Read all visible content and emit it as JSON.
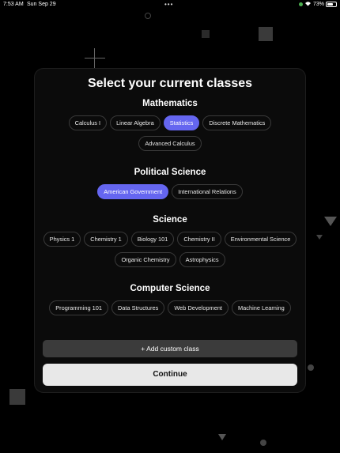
{
  "status_bar": {
    "time": "7:53 AM",
    "date": "Sun Sep 29",
    "dots": "•••",
    "battery_text": "73%",
    "battery_level": 0.73
  },
  "title": "Select your current classes",
  "sections": [
    {
      "name": "Mathematics",
      "chips": [
        {
          "label": "Calculus I",
          "selected": false
        },
        {
          "label": "Linear Algebra",
          "selected": false
        },
        {
          "label": "Statistics",
          "selected": true
        },
        {
          "label": "Discrete Mathematics",
          "selected": false
        },
        {
          "label": "Advanced Calculus",
          "selected": false
        }
      ]
    },
    {
      "name": "Political Science",
      "chips": [
        {
          "label": "American Government",
          "selected": true
        },
        {
          "label": "International Relations",
          "selected": false
        }
      ]
    },
    {
      "name": "Science",
      "chips": [
        {
          "label": "Physics 1",
          "selected": false
        },
        {
          "label": "Chemistry 1",
          "selected": false
        },
        {
          "label": "Biology 101",
          "selected": false
        },
        {
          "label": "Chemistry II",
          "selected": false
        },
        {
          "label": "Environmental Science",
          "selected": false
        },
        {
          "label": "Organic Chemistry",
          "selected": false
        },
        {
          "label": "Astrophysics",
          "selected": false
        }
      ]
    },
    {
      "name": "Computer Science",
      "chips": [
        {
          "label": "Programming 101",
          "selected": false
        },
        {
          "label": "Data Structures",
          "selected": false
        },
        {
          "label": "Web Development",
          "selected": false
        },
        {
          "label": "Machine Learning",
          "selected": false
        }
      ]
    }
  ],
  "add_custom_label": "+ Add custom class",
  "continue_label": "Continue",
  "colors": {
    "accent": "#6566f0",
    "background": "#000000",
    "card": "#0b0b0b"
  }
}
